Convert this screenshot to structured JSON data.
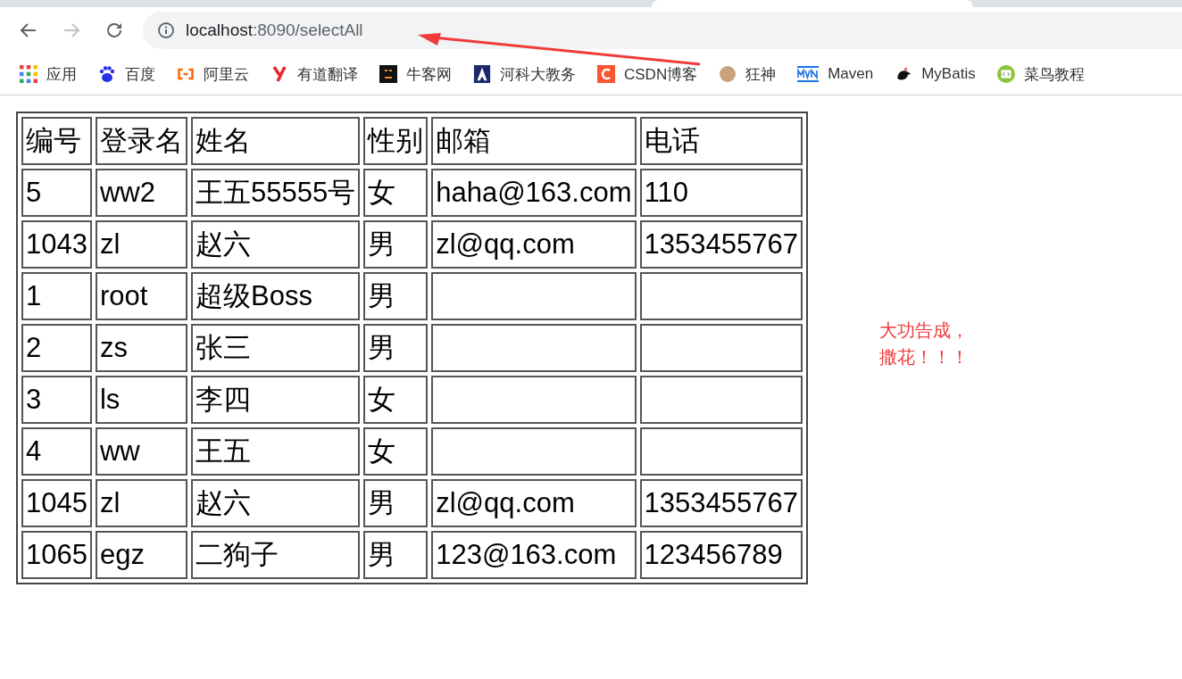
{
  "address_bar": {
    "url_host": "localhost",
    "url_path": ":8090/selectAll"
  },
  "bookmarks": [
    {
      "label": "应用",
      "kind": "apps"
    },
    {
      "label": "百度",
      "kind": "paw"
    },
    {
      "label": "阿里云",
      "kind": "bracket"
    },
    {
      "label": "有道翻译",
      "kind": "y"
    },
    {
      "label": "牛客网",
      "kind": "square"
    },
    {
      "label": "河科大教务",
      "kind": "shield"
    },
    {
      "label": "CSDN博客",
      "kind": "c"
    },
    {
      "label": "狂神",
      "kind": "avatar"
    },
    {
      "label": "Maven",
      "kind": "mvn"
    },
    {
      "label": "MyBatis",
      "kind": "bird"
    },
    {
      "label": "菜鸟教程",
      "kind": "code"
    }
  ],
  "table": {
    "columns": [
      "编号",
      "登录名",
      "姓名",
      "性别",
      "邮箱",
      "电话"
    ],
    "rows": [
      [
        "5",
        "ww2",
        "王五55555号",
        "女",
        "haha@163.com",
        "110"
      ],
      [
        "1043",
        "zl",
        "赵六",
        "男",
        "zl@qq.com",
        "1353455767"
      ],
      [
        "1",
        "root",
        "超级Boss",
        "男",
        "",
        ""
      ],
      [
        "2",
        "zs",
        "张三",
        "男",
        "",
        ""
      ],
      [
        "3",
        "ls",
        "李四",
        "女",
        "",
        ""
      ],
      [
        "4",
        "ww",
        "王五",
        "女",
        "",
        ""
      ],
      [
        "1045",
        "zl",
        "赵六",
        "男",
        "zl@qq.com",
        "1353455767"
      ],
      [
        "1065",
        "egz",
        "二狗子",
        "男",
        "123@163.com",
        "123456789"
      ]
    ]
  },
  "note": [
    "大功告成，",
    "撒花！！！"
  ]
}
